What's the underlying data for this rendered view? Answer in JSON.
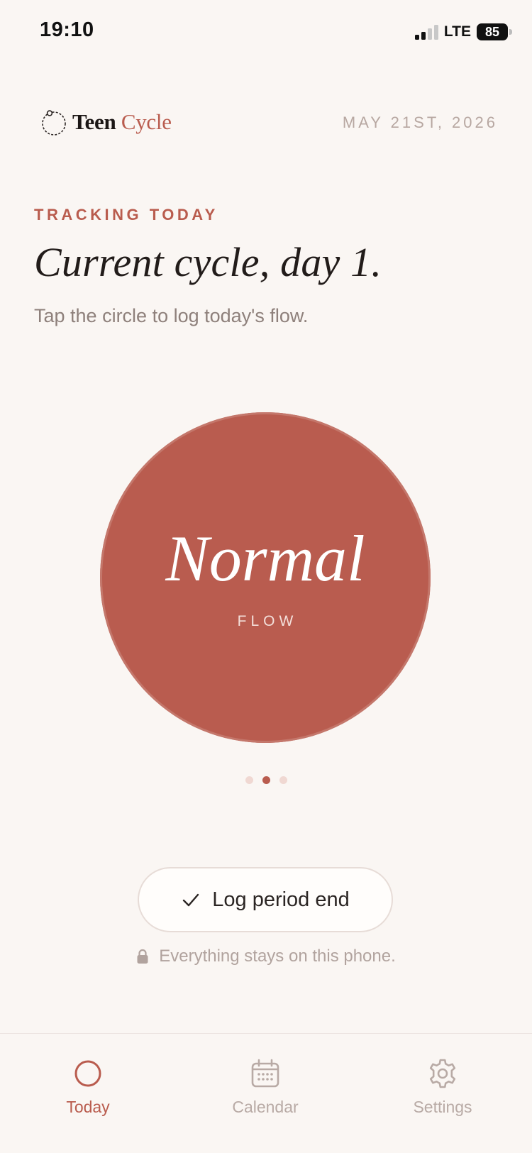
{
  "status_bar": {
    "time": "19:10",
    "network": "LTE",
    "battery": "85"
  },
  "header": {
    "brand_word1": "Teen",
    "brand_word2": "Cycle",
    "date": "MAY 21ST, 2026"
  },
  "intro": {
    "eyebrow": "TRACKING TODAY",
    "title": "Current cycle, day 1.",
    "subtitle": "Tap the circle to log today's flow."
  },
  "flow": {
    "value": "Normal",
    "label": "FLOW",
    "level_index": 1,
    "level_count": 3
  },
  "action": {
    "label": "Log period end"
  },
  "privacy": {
    "text": "Everything stays on this phone."
  },
  "tabs": [
    {
      "label": "Today",
      "icon": "circle-icon",
      "active": true
    },
    {
      "label": "Calendar",
      "icon": "calendar-icon",
      "active": false
    },
    {
      "label": "Settings",
      "icon": "gear-icon",
      "active": false
    }
  ],
  "colors": {
    "accent": "#b95c4e",
    "background": "#faf6f3",
    "muted": "#b8aaa5"
  }
}
